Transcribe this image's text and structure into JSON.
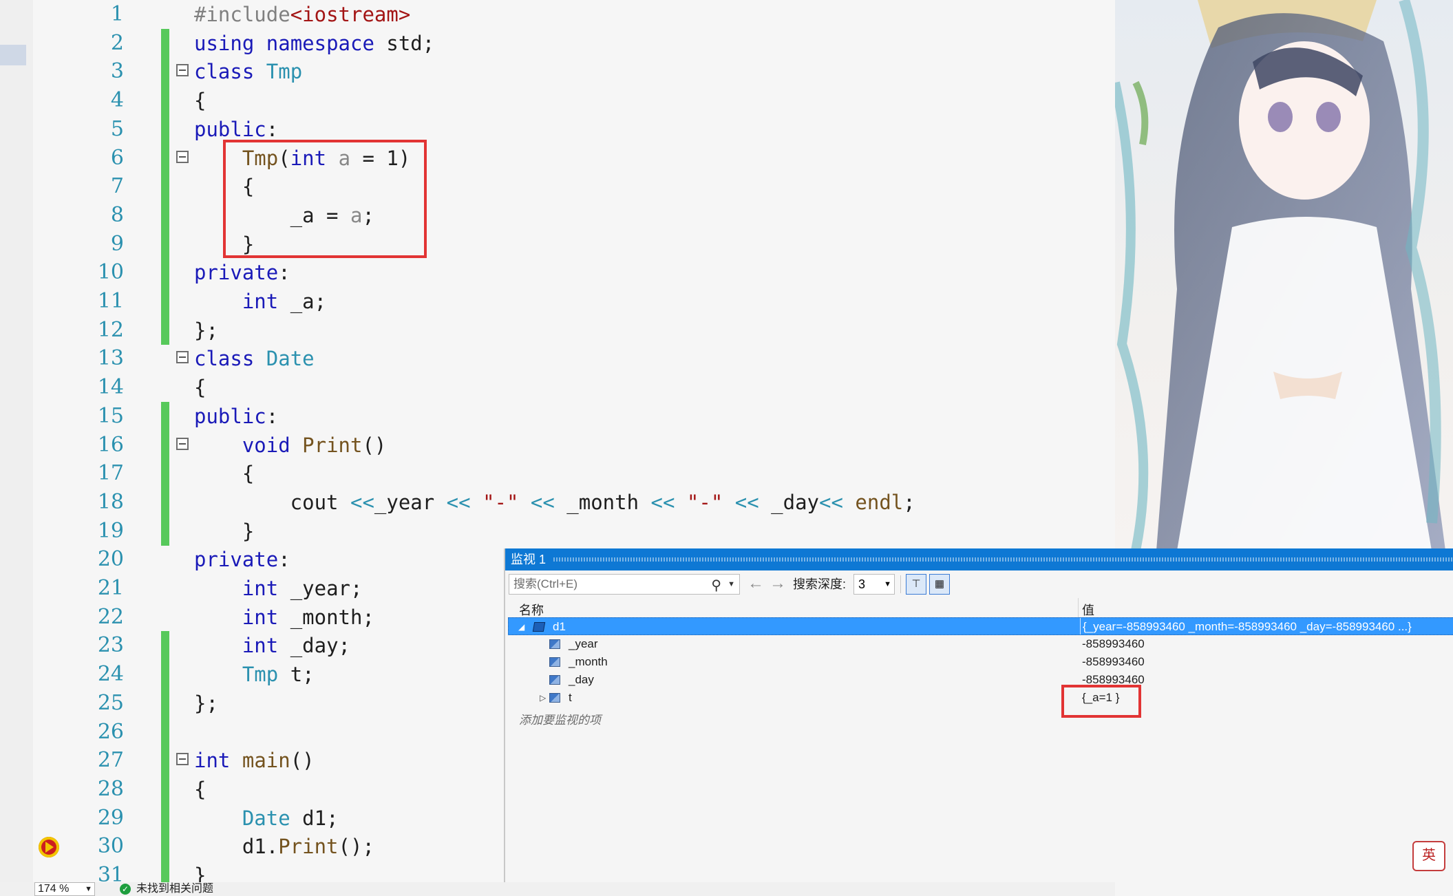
{
  "editor": {
    "lines": [
      {
        "n": "1",
        "html": "<span class=\"pp\">#include</span><span class=\"s\">&lt;iostream&gt;</span>"
      },
      {
        "n": "2",
        "html": "<span class=\"k\">using</span> <span class=\"k\">namespace</span> std;"
      },
      {
        "n": "3",
        "html": "<span class=\"k\">class</span> <span class=\"t\">Tmp</span>"
      },
      {
        "n": "4",
        "html": "{"
      },
      {
        "n": "5",
        "html": "<span class=\"k\">public</span>:"
      },
      {
        "n": "6",
        "html": "    <span class=\"f\">Tmp</span>(<span class=\"k\">int</span> <span class=\"p\">a</span> = 1)"
      },
      {
        "n": "7",
        "html": "    {"
      },
      {
        "n": "8",
        "html": "        _a = <span class=\"p\">a</span>;"
      },
      {
        "n": "9",
        "html": "    }"
      },
      {
        "n": "10",
        "html": "<span class=\"k\">private</span>:"
      },
      {
        "n": "11",
        "html": "    <span class=\"k\">int</span> _a;"
      },
      {
        "n": "12",
        "html": "};"
      },
      {
        "n": "13",
        "html": "<span class=\"k\">class</span> <span class=\"t\">Date</span>"
      },
      {
        "n": "14",
        "html": "{"
      },
      {
        "n": "15",
        "html": "<span class=\"k\">public</span>:"
      },
      {
        "n": "16",
        "html": "    <span class=\"k\">void</span> <span class=\"f\">Print</span>()"
      },
      {
        "n": "17",
        "html": "    {"
      },
      {
        "n": "18",
        "html": "        cout <span class=\"t\">&lt;&lt;</span>_year <span class=\"t\">&lt;&lt;</span> <span class=\"s\">\"-\"</span> <span class=\"t\">&lt;&lt;</span> _month <span class=\"t\">&lt;&lt;</span> <span class=\"s\">\"-\"</span> <span class=\"t\">&lt;&lt;</span> _day<span class=\"t\">&lt;&lt;</span> <span class=\"f\">endl</span>;"
      },
      {
        "n": "19",
        "html": "    }"
      },
      {
        "n": "20",
        "html": "<span class=\"k\">private</span>:"
      },
      {
        "n": "21",
        "html": "    <span class=\"k\">int</span> _year;"
      },
      {
        "n": "22",
        "html": "    <span class=\"k\">int</span> _month;"
      },
      {
        "n": "23",
        "html": "    <span class=\"k\">int</span> _day;"
      },
      {
        "n": "24",
        "html": "    <span class=\"t\">Tmp</span> t;"
      },
      {
        "n": "25",
        "html": "};"
      },
      {
        "n": "26",
        "html": ""
      },
      {
        "n": "27",
        "html": "<span class=\"k\">int</span> <span class=\"f\">main</span>()"
      },
      {
        "n": "28",
        "html": "{"
      },
      {
        "n": "29",
        "html": "    <span class=\"t\">Date</span> d1;"
      },
      {
        "n": "30",
        "html": "    d1.<span class=\"f\">Print</span>();"
      },
      {
        "n": "31",
        "html": "}"
      }
    ]
  },
  "status": {
    "zoom": "174 %",
    "issues": "未找到相关问题"
  },
  "watch": {
    "title": "监视 1",
    "search_placeholder": "搜索(Ctrl+E)",
    "depth_label": "搜索深度:",
    "depth_value": "3",
    "col_name": "名称",
    "col_value": "值",
    "rows": [
      {
        "name": "d1",
        "value": "{_year=-858993460 _month=-858993460 _day=-858993460 ...}"
      },
      {
        "name": "_year",
        "value": "-858993460"
      },
      {
        "name": "_month",
        "value": "-858993460"
      },
      {
        "name": "_day",
        "value": "-858993460"
      },
      {
        "name": "t",
        "value": "{_a=1 }"
      }
    ],
    "add_item": "添加要监视的项"
  },
  "ime": {
    "label": "英"
  },
  "colors": {
    "accent": "#0e78d4",
    "selection": "#3399ff",
    "change_bar": "#57c95b",
    "highlight": "#e23434"
  }
}
